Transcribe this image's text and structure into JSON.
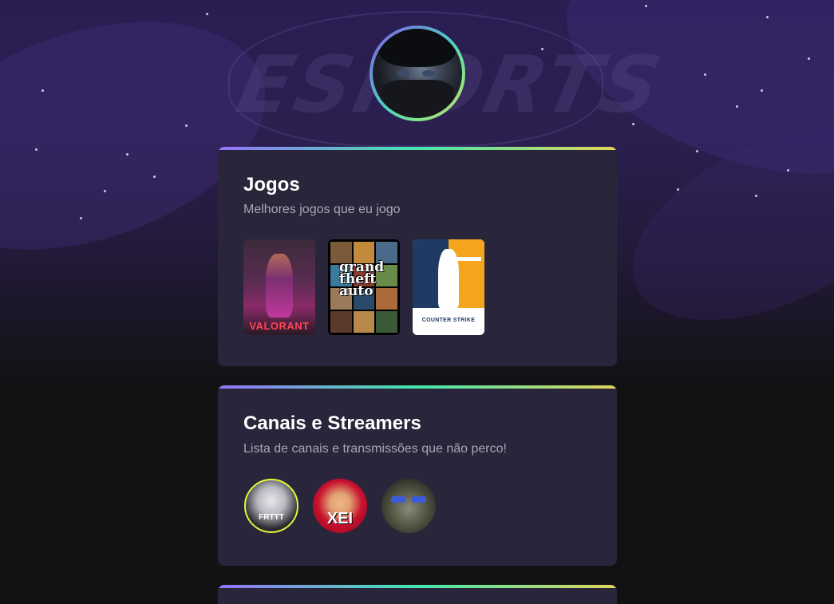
{
  "profile": {
    "avatar_icon": "profile-avatar-icon",
    "ring_colors": [
      "#8257e5",
      "#4ecdc4",
      "#7ee787",
      "#e6d36a"
    ]
  },
  "background": {
    "logo_text": "ESPORTS"
  },
  "sections": [
    {
      "title": "Jogos",
      "subtitle": "Melhores jogos que eu jogo",
      "games": [
        {
          "name": "Valorant",
          "label": "VALORANT"
        },
        {
          "name": "Grand Theft Auto V",
          "label": "grand theft auto"
        },
        {
          "name": "Counter-Strike",
          "label": "COUNTER STRIKE"
        }
      ]
    },
    {
      "title": "Canais e Streamers",
      "subtitle": "Lista de canais e transmissões que não perco!",
      "channels": [
        {
          "label": "FRTTT"
        },
        {
          "label": "XEI"
        },
        {
          "label": ""
        }
      ]
    }
  ],
  "colors": {
    "card_bg": "#29253a",
    "page_bg": "#121214",
    "subtitle": "#a8a8b3",
    "gradient_border": [
      "#9572fc",
      "#43e7ad",
      "#e2d45c"
    ]
  }
}
